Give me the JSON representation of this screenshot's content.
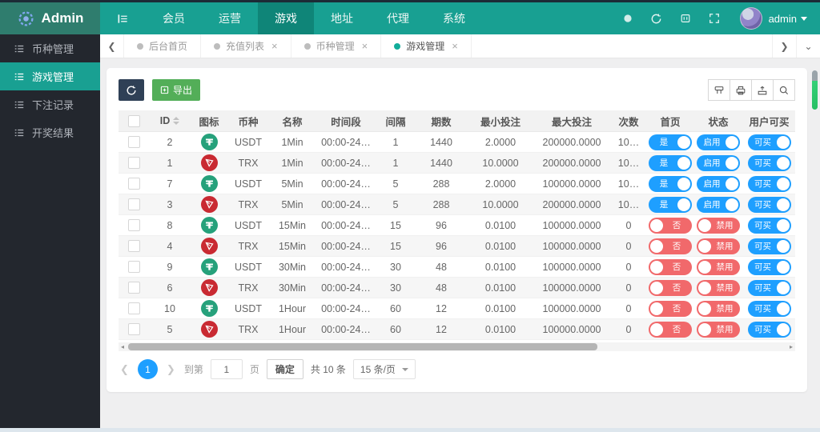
{
  "navbar": {
    "brand": "Admin",
    "menu": [
      {
        "label": "",
        "icon": "list-icon",
        "active": false
      },
      {
        "label": "会员",
        "active": false
      },
      {
        "label": "运营",
        "active": false
      },
      {
        "label": "游戏",
        "active": true
      },
      {
        "label": "地址",
        "active": false
      },
      {
        "label": "代理",
        "active": false
      },
      {
        "label": "系统",
        "active": false
      }
    ],
    "right_icons": [
      "dot-icon",
      "refresh-icon",
      "clear-icon",
      "fullscreen-icon"
    ],
    "username": "admin"
  },
  "sidebar": {
    "items": [
      {
        "label": "币种管理",
        "active": false
      },
      {
        "label": "游戏管理",
        "active": true
      },
      {
        "label": "下注记录",
        "active": false
      },
      {
        "label": "开奖结果",
        "active": false
      }
    ]
  },
  "tabbar": {
    "tabs": [
      {
        "label": "后台首页",
        "closable": false,
        "active": false
      },
      {
        "label": "充值列表",
        "closable": true,
        "active": false
      },
      {
        "label": "币种管理",
        "closable": true,
        "active": false
      },
      {
        "label": "游戏管理",
        "closable": true,
        "active": true
      }
    ]
  },
  "toolbar": {
    "export_label": "导出",
    "tools": [
      "columns-icon",
      "printer-icon",
      "export-icon",
      "search-icon"
    ]
  },
  "table": {
    "columns": [
      "ID",
      "图标",
      "币种",
      "名称",
      "时间段",
      "间隔",
      "期数",
      "最小投注",
      "最大投注",
      "次数",
      "首页",
      "状态",
      "用户可买"
    ],
    "rows": [
      {
        "id": "2",
        "coin": "USDT",
        "icon": "usdt",
        "name": "1Min",
        "time": "00:00-24…",
        "interval": "1",
        "periods": "1440",
        "min": "2.0000",
        "max": "200000.0000",
        "count": "10…",
        "home_label": "是",
        "home_on": true,
        "status_label": "启用",
        "status_on": true,
        "buy_label": "可买",
        "buy_on": true
      },
      {
        "id": "1",
        "coin": "TRX",
        "icon": "trx",
        "name": "1Min",
        "time": "00:00-24…",
        "interval": "1",
        "periods": "1440",
        "min": "10.0000",
        "max": "200000.0000",
        "count": "10…",
        "home_label": "是",
        "home_on": true,
        "status_label": "启用",
        "status_on": true,
        "buy_label": "可买",
        "buy_on": true
      },
      {
        "id": "7",
        "coin": "USDT",
        "icon": "usdt",
        "name": "5Min",
        "time": "00:00-24…",
        "interval": "5",
        "periods": "288",
        "min": "2.0000",
        "max": "100000.0000",
        "count": "10…",
        "home_label": "是",
        "home_on": true,
        "status_label": "启用",
        "status_on": true,
        "buy_label": "可买",
        "buy_on": true
      },
      {
        "id": "3",
        "coin": "TRX",
        "icon": "trx",
        "name": "5Min",
        "time": "00:00-24…",
        "interval": "5",
        "periods": "288",
        "min": "10.0000",
        "max": "200000.0000",
        "count": "10…",
        "home_label": "是",
        "home_on": true,
        "status_label": "启用",
        "status_on": true,
        "buy_label": "可买",
        "buy_on": true
      },
      {
        "id": "8",
        "coin": "USDT",
        "icon": "usdt",
        "name": "15Min",
        "time": "00:00-24…",
        "interval": "15",
        "periods": "96",
        "min": "0.0100",
        "max": "100000.0000",
        "count": "0",
        "home_label": "否",
        "home_on": false,
        "status_label": "禁用",
        "status_on": false,
        "buy_label": "可买",
        "buy_on": true
      },
      {
        "id": "4",
        "coin": "TRX",
        "icon": "trx",
        "name": "15Min",
        "time": "00:00-24…",
        "interval": "15",
        "periods": "96",
        "min": "0.0100",
        "max": "100000.0000",
        "count": "0",
        "home_label": "否",
        "home_on": false,
        "status_label": "禁用",
        "status_on": false,
        "buy_label": "可买",
        "buy_on": true
      },
      {
        "id": "9",
        "coin": "USDT",
        "icon": "usdt",
        "name": "30Min",
        "time": "00:00-24…",
        "interval": "30",
        "periods": "48",
        "min": "0.0100",
        "max": "100000.0000",
        "count": "0",
        "home_label": "否",
        "home_on": false,
        "status_label": "禁用",
        "status_on": false,
        "buy_label": "可买",
        "buy_on": true
      },
      {
        "id": "6",
        "coin": "TRX",
        "icon": "trx",
        "name": "30Min",
        "time": "00:00-24…",
        "interval": "30",
        "periods": "48",
        "min": "0.0100",
        "max": "100000.0000",
        "count": "0",
        "home_label": "否",
        "home_on": false,
        "status_label": "禁用",
        "status_on": false,
        "buy_label": "可买",
        "buy_on": true
      },
      {
        "id": "10",
        "coin": "USDT",
        "icon": "usdt",
        "name": "1Hour",
        "time": "00:00-24…",
        "interval": "60",
        "periods": "12",
        "min": "0.0100",
        "max": "100000.0000",
        "count": "0",
        "home_label": "否",
        "home_on": false,
        "status_label": "禁用",
        "status_on": false,
        "buy_label": "可买",
        "buy_on": true
      },
      {
        "id": "5",
        "coin": "TRX",
        "icon": "trx",
        "name": "1Hour",
        "time": "00:00-24…",
        "interval": "60",
        "periods": "12",
        "min": "0.0100",
        "max": "100000.0000",
        "count": "0",
        "home_label": "否",
        "home_on": false,
        "status_label": "禁用",
        "status_on": false,
        "buy_label": "可买",
        "buy_on": true
      }
    ]
  },
  "pagination": {
    "page": "1",
    "goto_prefix": "到第",
    "page_value": "1",
    "goto_suffix": "页",
    "confirm": "确定",
    "total": "共 10 条",
    "page_size": "15 条/页"
  },
  "colors": {
    "accent": "#19A092",
    "brand_bg": "#2F7D6E",
    "toggle_on": "#1E9FFF",
    "toggle_off": "#F1696B",
    "export_green": "#53AE58",
    "sidebar_bg": "#23272E",
    "scroll_green": "#2BC46A"
  }
}
